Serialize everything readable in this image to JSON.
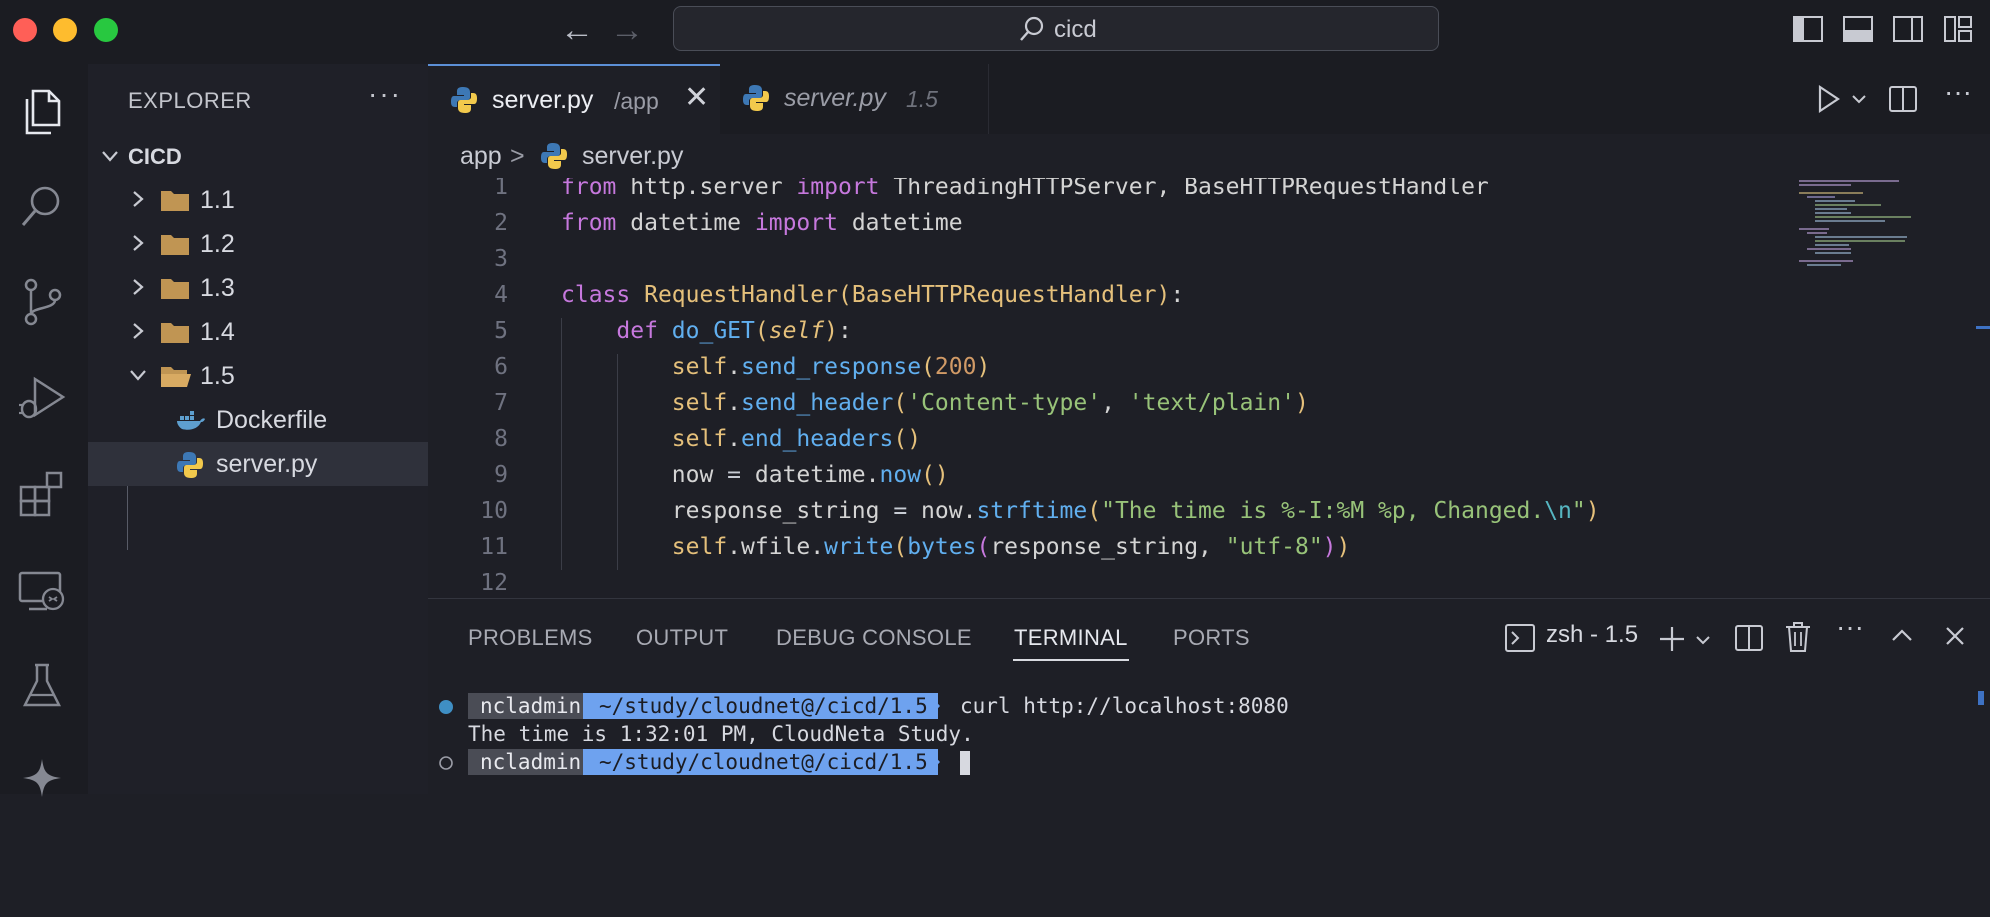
{
  "window": {
    "search_text": "cicd"
  },
  "sidebar": {
    "title": "EXPLORER",
    "root": "CICD",
    "folders": [
      "1.1",
      "1.2",
      "1.3",
      "1.4",
      "1.5"
    ],
    "files": [
      "Dockerfile",
      "server.py"
    ]
  },
  "tabs": [
    {
      "label": "server.py",
      "description": "/app"
    },
    {
      "label": "server.py",
      "description": "1.5"
    }
  ],
  "breadcrumb": {
    "folder": "app",
    "separator": ">",
    "file": "server.py"
  },
  "code": {
    "line_numbers": [
      "1",
      "2",
      "3",
      "4",
      "5",
      "6",
      "7",
      "8",
      "9",
      "10",
      "11",
      "12"
    ],
    "lines": [
      "from http.server import ThreadingHTTPServer, BaseHTTPRequestHandler",
      "from datetime import datetime",
      "",
      "class RequestHandler(BaseHTTPRequestHandler):",
      "    def do_GET(self):",
      "        self.send_response(200)",
      "        self.send_header('Content-type', 'text/plain')",
      "        self.end_headers()",
      "        now = datetime.now()",
      "        response_string = now.strftime(\"The time is %-I:%M %p, Changed.\\n\")",
      "        self.wfile.write(bytes(response_string, \"utf-8\"))",
      ""
    ]
  },
  "panel": {
    "tabs": [
      "PROBLEMS",
      "OUTPUT",
      "DEBUG CONSOLE",
      "TERMINAL",
      "PORTS"
    ],
    "active_tab": "TERMINAL",
    "terminal_name": "zsh - 1.5"
  },
  "terminal": {
    "user": "ncladmin",
    "path": "~/study/cloudnet@/cicd/1.5",
    "command": "curl http://localhost:8080",
    "output": "The time is 1:32:01 PM, CloudNeta Study."
  },
  "colors": {
    "keyword": "#c678dd",
    "class": "#e5c07b",
    "function": "#61afef",
    "string": "#98c379",
    "number": "#d19a66",
    "accent": "#6ea2ef"
  }
}
